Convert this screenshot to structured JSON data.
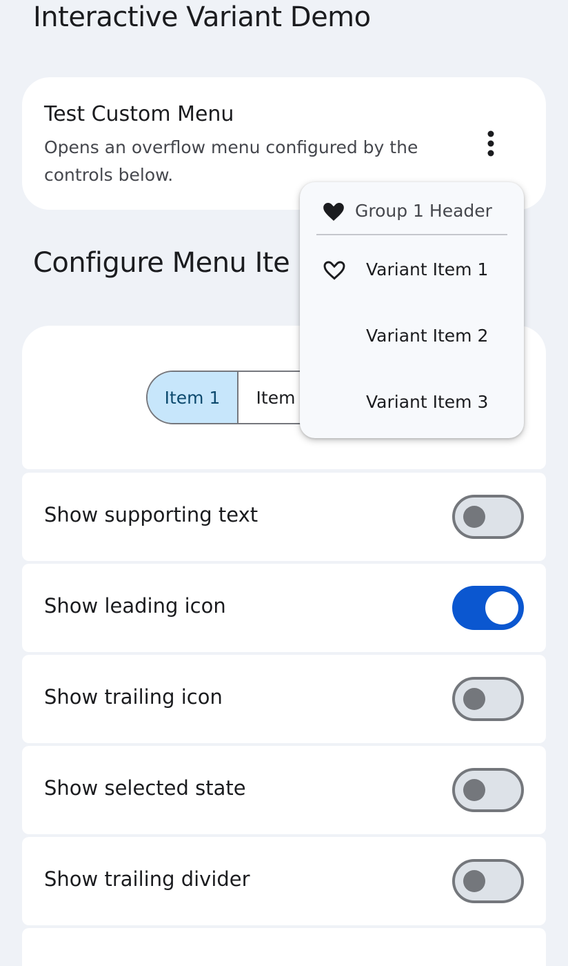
{
  "page": {
    "title": "Interactive Variant Demo"
  },
  "test_card": {
    "title": "Test Custom Menu",
    "description": "Opens an overflow menu configured by the controls below.",
    "overflow_icon": "more-vert-icon"
  },
  "configure": {
    "title": "Configure Menu Ite",
    "segments": [
      {
        "label": "Item 1",
        "selected": true
      },
      {
        "label": "Item",
        "selected": false
      },
      {
        "label": "",
        "selected": false
      }
    ]
  },
  "toggles": [
    {
      "label": "Show supporting text",
      "on": false
    },
    {
      "label": "Show leading icon",
      "on": true
    },
    {
      "label": "Show trailing icon",
      "on": false
    },
    {
      "label": "Show selected state",
      "on": false
    },
    {
      "label": "Show trailing divider",
      "on": false
    }
  ],
  "menu": {
    "header": {
      "label": "Group 1 Header",
      "icon": "heart-filled-icon"
    },
    "items": [
      {
        "label": "Variant Item 1",
        "icon": "heart-outline-icon"
      },
      {
        "label": "Variant Item 2",
        "icon": ""
      },
      {
        "label": "Variant Item 3",
        "icon": ""
      }
    ]
  },
  "colors": {
    "background": "#eff2f7",
    "surface": "#ffffff",
    "primary": "#0b57d0",
    "selected_segment": "#c7e6fb",
    "switch_off_track": "#dde2e8",
    "switch_off_outline": "#74777c"
  }
}
